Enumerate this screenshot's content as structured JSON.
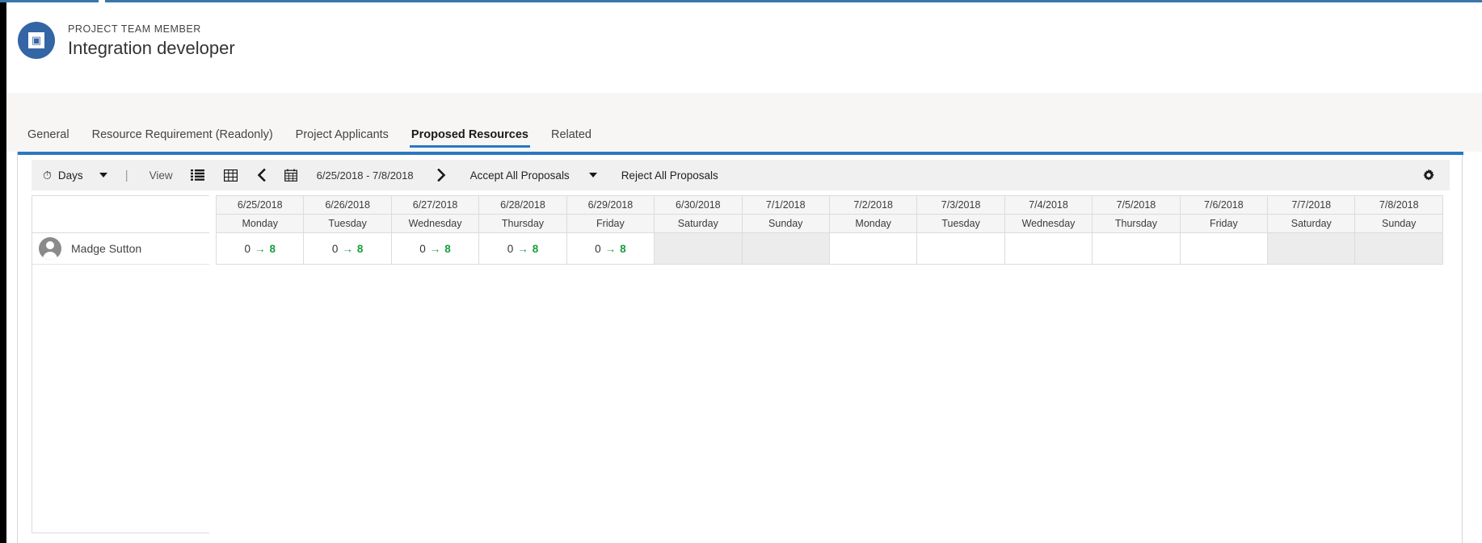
{
  "record": {
    "eyebrow": "PROJECT TEAM MEMBER",
    "title": "Integration developer",
    "avatar_icon": "team-member-icon"
  },
  "tabs": [
    {
      "label": "General",
      "active": false
    },
    {
      "label": "Resource Requirement (Readonly)",
      "active": false
    },
    {
      "label": "Project Applicants",
      "active": false
    },
    {
      "label": "Proposed Resources",
      "active": true
    },
    {
      "label": "Related",
      "active": false
    }
  ],
  "toolbar": {
    "scale_icon": "clock-icon",
    "scale_label": "Days",
    "scale_caret": "chevron-down-icon",
    "separator": "|",
    "view_label": "View",
    "list_view_icon": "list-view-icon",
    "grid_view_icon": "grid-view-icon",
    "prev_icon": "chevron-left-icon",
    "calendar_icon": "calendar-icon",
    "date_range": "6/25/2018 - 7/8/2018",
    "next_icon": "chevron-right-icon",
    "accept_all_label": "Accept All Proposals",
    "accept_all_caret": "chevron-down-icon",
    "reject_all_label": "Reject All Proposals",
    "settings_icon": "gear-icon"
  },
  "grid": {
    "columns": [
      {
        "date": "6/25/2018",
        "day": "Monday",
        "weekend": false
      },
      {
        "date": "6/26/2018",
        "day": "Tuesday",
        "weekend": false
      },
      {
        "date": "6/27/2018",
        "day": "Wednesday",
        "weekend": false
      },
      {
        "date": "6/28/2018",
        "day": "Thursday",
        "weekend": false
      },
      {
        "date": "6/29/2018",
        "day": "Friday",
        "weekend": false
      },
      {
        "date": "6/30/2018",
        "day": "Saturday",
        "weekend": true
      },
      {
        "date": "7/1/2018",
        "day": "Sunday",
        "weekend": true
      },
      {
        "date": "7/2/2018",
        "day": "Monday",
        "weekend": false
      },
      {
        "date": "7/3/2018",
        "day": "Tuesday",
        "weekend": false
      },
      {
        "date": "7/4/2018",
        "day": "Wednesday",
        "weekend": false
      },
      {
        "date": "7/5/2018",
        "day": "Thursday",
        "weekend": false
      },
      {
        "date": "7/6/2018",
        "day": "Friday",
        "weekend": false
      },
      {
        "date": "7/7/2018",
        "day": "Saturday",
        "weekend": true
      },
      {
        "date": "7/8/2018",
        "day": "Sunday",
        "weekend": true
      }
    ],
    "rows": [
      {
        "name": "Madge Sutton",
        "avatar_icon": "person-avatar-icon",
        "cells": [
          {
            "from": "0",
            "arrow": "→",
            "to": "8"
          },
          {
            "from": "0",
            "arrow": "→",
            "to": "8"
          },
          {
            "from": "0",
            "arrow": "→",
            "to": "8"
          },
          {
            "from": "0",
            "arrow": "→",
            "to": "8"
          },
          {
            "from": "0",
            "arrow": "→",
            "to": "8"
          },
          null,
          null,
          null,
          null,
          null,
          null,
          null,
          null,
          null
        ]
      }
    ]
  },
  "colors": {
    "accent_blue": "#2b78c2",
    "avatar_blue": "#3465a4",
    "proposed_green": "#14a03a",
    "weekend_gray": "#ececec",
    "toolbar_gray": "#f0f0f0"
  }
}
